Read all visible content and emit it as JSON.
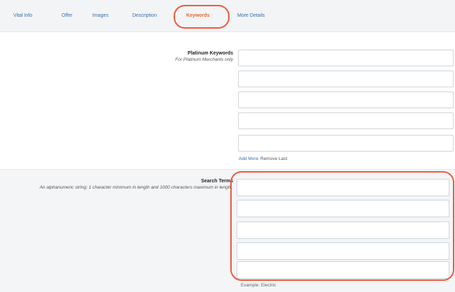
{
  "tabs": [
    {
      "label": "Vital Info"
    },
    {
      "label": "Offer"
    },
    {
      "label": "Images"
    },
    {
      "label": "Description"
    },
    {
      "label": "Keywords"
    },
    {
      "label": "More Details"
    }
  ],
  "platinum": {
    "title": "Platinum Keywords",
    "subtitle": "For Platinum Merchants only",
    "fields": [
      "",
      "",
      "",
      "",
      ""
    ],
    "add_more": "Add More",
    "remove_last": "Remove Last"
  },
  "search_terms": {
    "title": "Search Terms",
    "subtitle": "An alphanumeric string; 1 character minimum in length and 1000 characters maximum in length.",
    "fields": [
      "",
      "",
      "",
      "",
      ""
    ],
    "example": "Example:  Electric"
  },
  "colors": {
    "highlight": "#ee5a3c",
    "link": "#3a6fa8",
    "active_tab": "#e06b2d"
  }
}
